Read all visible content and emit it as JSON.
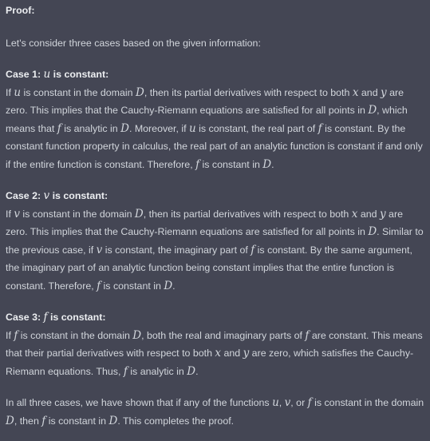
{
  "heading": "Proof:",
  "intro": [
    {
      "t": "Let's consider three cases based on the given information:"
    }
  ],
  "cases": [
    {
      "title": [
        {
          "t": "Case 1: "
        },
        {
          "m": "u"
        },
        {
          "t": " is constant:"
        }
      ],
      "body": [
        {
          "t": "If "
        },
        {
          "m": "u"
        },
        {
          "t": " is constant in the domain "
        },
        {
          "m": "D"
        },
        {
          "t": ", then its partial derivatives with respect to both "
        },
        {
          "m": "x"
        },
        {
          "t": " and "
        },
        {
          "m": "y"
        },
        {
          "t": " are zero. This implies that the Cauchy-Riemann equations are satisfied for all points in "
        },
        {
          "m": "D"
        },
        {
          "t": ", which means that "
        },
        {
          "m": "f"
        },
        {
          "t": " is analytic in "
        },
        {
          "m": "D"
        },
        {
          "t": ". Moreover, if "
        },
        {
          "m": "u"
        },
        {
          "t": " is constant, the real part of "
        },
        {
          "m": "f"
        },
        {
          "t": " is constant. By the constant function property in calculus, the real part of an analytic function is constant if and only if the entire function is constant. Therefore, "
        },
        {
          "m": "f"
        },
        {
          "t": " is constant in "
        },
        {
          "m": "D"
        },
        {
          "t": "."
        }
      ]
    },
    {
      "title": [
        {
          "t": "Case 2: "
        },
        {
          "m": "v"
        },
        {
          "t": " is constant:"
        }
      ],
      "body": [
        {
          "t": "If "
        },
        {
          "m": "v"
        },
        {
          "t": " is constant in the domain "
        },
        {
          "m": "D"
        },
        {
          "t": ", then its partial derivatives with respect to both "
        },
        {
          "m": "x"
        },
        {
          "t": " and "
        },
        {
          "m": "y"
        },
        {
          "t": " are zero. This implies that the Cauchy-Riemann equations are satisfied for all points in "
        },
        {
          "m": "D"
        },
        {
          "t": ". Similar to the previous case, if "
        },
        {
          "m": "v"
        },
        {
          "t": " is constant, the imaginary part of "
        },
        {
          "m": "f"
        },
        {
          "t": " is constant. By the same argument, the imaginary part of an analytic function being constant implies that the entire function is constant. Therefore, "
        },
        {
          "m": "f"
        },
        {
          "t": " is constant in "
        },
        {
          "m": "D"
        },
        {
          "t": "."
        }
      ]
    },
    {
      "title": [
        {
          "t": "Case 3: "
        },
        {
          "m": "f"
        },
        {
          "t": " is constant:"
        }
      ],
      "body": [
        {
          "t": "If "
        },
        {
          "m": "f"
        },
        {
          "t": " is constant in the domain "
        },
        {
          "m": "D"
        },
        {
          "t": ", both the real and imaginary parts of "
        },
        {
          "m": "f"
        },
        {
          "t": " are constant. This means that their partial derivatives with respect to both "
        },
        {
          "m": "x"
        },
        {
          "t": " and "
        },
        {
          "m": "y"
        },
        {
          "t": " are zero, which satisfies the Cauchy-Riemann equations. Thus, "
        },
        {
          "m": "f"
        },
        {
          "t": " is analytic in "
        },
        {
          "m": "D"
        },
        {
          "t": "."
        }
      ]
    }
  ],
  "conclusion": [
    {
      "t": "In all three cases, we have shown that if any of the functions "
    },
    {
      "m": "u"
    },
    {
      "t": ", "
    },
    {
      "m": "v"
    },
    {
      "t": ", or "
    },
    {
      "m": "f"
    },
    {
      "t": " is constant in the domain "
    },
    {
      "m": "D"
    },
    {
      "t": ", then "
    },
    {
      "m": "f"
    },
    {
      "t": " is constant in "
    },
    {
      "m": "D"
    },
    {
      "t": ". This completes the proof."
    }
  ]
}
